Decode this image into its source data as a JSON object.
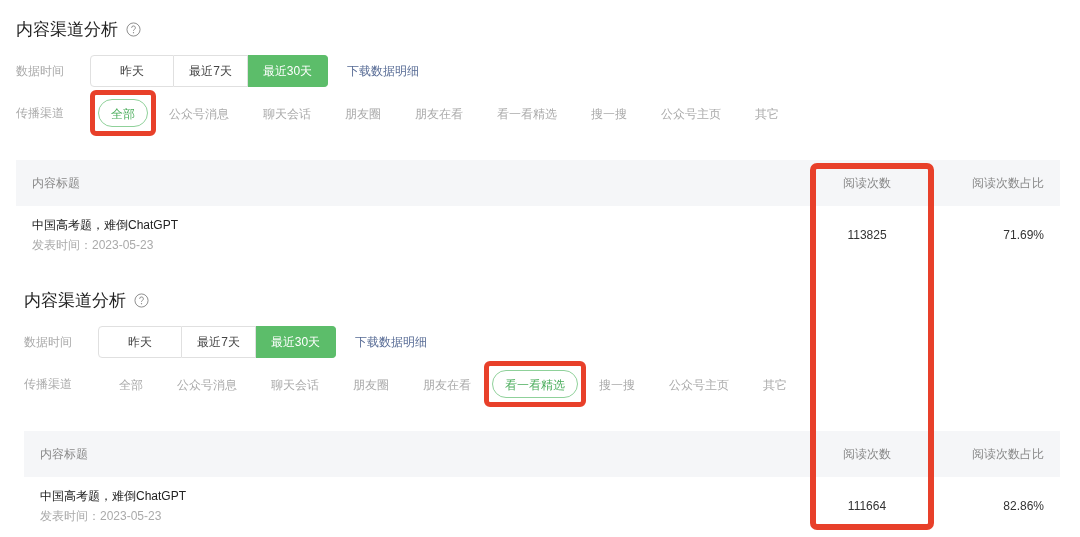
{
  "panels": [
    {
      "title": "内容渠道分析",
      "time_label": "数据时间",
      "time_ranges": [
        {
          "label": "昨天",
          "selected": false
        },
        {
          "label": "最近7天",
          "selected": false
        },
        {
          "label": "最近30天",
          "selected": true
        }
      ],
      "download_link": "下载数据明细",
      "channel_label": "传播渠道",
      "channels": [
        {
          "label": "全部",
          "selected": true,
          "highlighted": true
        },
        {
          "label": "公众号消息",
          "selected": false,
          "highlighted": false
        },
        {
          "label": "聊天会话",
          "selected": false,
          "highlighted": false
        },
        {
          "label": "朋友圈",
          "selected": false,
          "highlighted": false
        },
        {
          "label": "朋友在看",
          "selected": false,
          "highlighted": false
        },
        {
          "label": "看一看精选",
          "selected": false,
          "highlighted": false
        },
        {
          "label": "搜一搜",
          "selected": false,
          "highlighted": false
        },
        {
          "label": "公众号主页",
          "selected": false,
          "highlighted": false
        },
        {
          "label": "其它",
          "selected": false,
          "highlighted": false
        }
      ],
      "table": {
        "columns": [
          {
            "label": "内容标题",
            "highlighted": false
          },
          {
            "label": "阅读次数",
            "highlighted": true
          },
          {
            "label": "阅读次数占比",
            "highlighted": false
          }
        ],
        "rows": [
          {
            "title": "中国高考题，难倒ChatGPT",
            "published": "发表时间：2023-05-23",
            "reads": "113825",
            "share": "71.69%"
          }
        ]
      }
    },
    {
      "title": "内容渠道分析",
      "time_label": "数据时间",
      "time_ranges": [
        {
          "label": "昨天",
          "selected": false
        },
        {
          "label": "最近7天",
          "selected": false
        },
        {
          "label": "最近30天",
          "selected": true
        }
      ],
      "download_link": "下载数据明细",
      "channel_label": "传播渠道",
      "channels": [
        {
          "label": "全部",
          "selected": false,
          "highlighted": false
        },
        {
          "label": "公众号消息",
          "selected": false,
          "highlighted": false
        },
        {
          "label": "聊天会话",
          "selected": false,
          "highlighted": false
        },
        {
          "label": "朋友圈",
          "selected": false,
          "highlighted": false
        },
        {
          "label": "朋友在看",
          "selected": false,
          "highlighted": false
        },
        {
          "label": "看一看精选",
          "selected": true,
          "highlighted": true
        },
        {
          "label": "搜一搜",
          "selected": false,
          "highlighted": false
        },
        {
          "label": "公众号主页",
          "selected": false,
          "highlighted": false
        },
        {
          "label": "其它",
          "selected": false,
          "highlighted": false
        }
      ],
      "table": {
        "columns": [
          {
            "label": "内容标题",
            "highlighted": false
          },
          {
            "label": "阅读次数",
            "highlighted": true
          },
          {
            "label": "阅读次数占比",
            "highlighted": false
          }
        ],
        "rows": [
          {
            "title": "中国高考题，难倒ChatGPT",
            "published": "发表时间：2023-05-23",
            "reads": "111664",
            "share": "82.86%"
          }
        ]
      }
    }
  ]
}
